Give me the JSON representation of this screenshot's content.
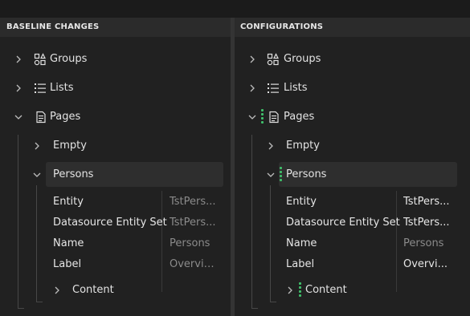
{
  "panels": {
    "left": {
      "header": "BASELINE CHANGES",
      "tree": {
        "groups": "Groups",
        "lists": "Lists",
        "pages": "Pages",
        "empty": "Empty",
        "persons": "Persons",
        "content": "Content"
      },
      "properties": [
        {
          "key": "Entity",
          "value": "TstPers..."
        },
        {
          "key": "Datasource Entity Set",
          "value": "TstPers..."
        },
        {
          "key": "Name",
          "value": "Persons"
        },
        {
          "key": "Label",
          "value": "Overvie..."
        }
      ]
    },
    "right": {
      "header": "CONFIGURATIONS",
      "tree": {
        "groups": "Groups",
        "lists": "Lists",
        "pages": "Pages",
        "empty": "Empty",
        "persons": "Persons",
        "content": "Content"
      },
      "properties": [
        {
          "key": "Entity",
          "value": "TstPers..."
        },
        {
          "key": "Datasource Entity Set",
          "value": "TstPers..."
        },
        {
          "key": "Name",
          "value": "Persons"
        },
        {
          "key": "Label",
          "value": "Overvi..."
        }
      ]
    }
  },
  "icons": {
    "chevron_right": "chevron-right-icon",
    "chevron_down": "chevron-down-icon",
    "groups": "groups-icon",
    "lists": "list-icon",
    "pages": "page-icon",
    "change_marker": "change-marker-icon"
  },
  "colors": {
    "background": "#212121",
    "header": "#2b2b2b",
    "selection": "#2e2e2e",
    "change_marker": "#3fbf6a",
    "muted_text": "#8b8b8b"
  }
}
